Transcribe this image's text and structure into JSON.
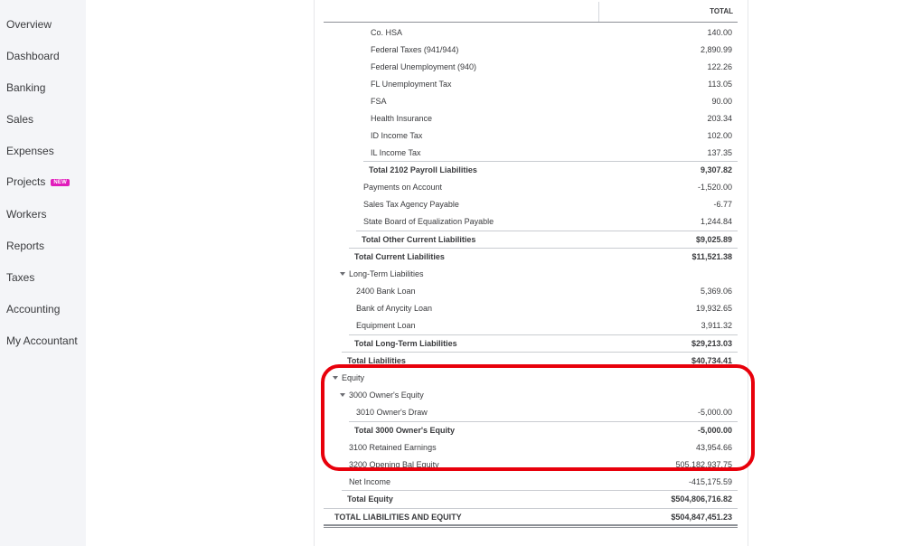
{
  "sidebar": {
    "items": [
      {
        "label": "Overview"
      },
      {
        "label": "Dashboard"
      },
      {
        "label": "Banking"
      },
      {
        "label": "Sales"
      },
      {
        "label": "Expenses"
      },
      {
        "label": "Projects",
        "badge": "NEW"
      },
      {
        "label": "Workers"
      },
      {
        "label": "Reports"
      },
      {
        "label": "Taxes"
      },
      {
        "label": "Accounting"
      },
      {
        "label": "My Accountant"
      }
    ]
  },
  "report": {
    "column_header": "TOTAL",
    "rows": [
      {
        "label": "Co. HSA",
        "amount": "140.00"
      },
      {
        "label": "Federal Taxes (941/944)",
        "amount": "2,890.99"
      },
      {
        "label": "Federal Unemployment (940)",
        "amount": "122.26"
      },
      {
        "label": "FL Unemployment Tax",
        "amount": "113.05"
      },
      {
        "label": "FSA",
        "amount": "90.00"
      },
      {
        "label": "Health Insurance",
        "amount": "203.34"
      },
      {
        "label": "ID Income Tax",
        "amount": "102.00"
      },
      {
        "label": "IL Income Tax",
        "amount": "137.35"
      },
      {
        "label": "Total 2102 Payroll Liabilities",
        "amount": "9,307.82"
      },
      {
        "label": "Payments on Account",
        "amount": "-1,520.00"
      },
      {
        "label": "Sales Tax Agency Payable",
        "amount": "-6.77"
      },
      {
        "label": "State Board of Equalization Payable",
        "amount": "1,244.84"
      },
      {
        "label": "Total Other Current Liabilities",
        "amount": "$9,025.89"
      },
      {
        "label": "Total Current Liabilities",
        "amount": "$11,521.38"
      },
      {
        "label": "Long-Term Liabilities",
        "amount": ""
      },
      {
        "label": "2400 Bank Loan",
        "amount": "5,369.06"
      },
      {
        "label": "Bank of Anycity Loan",
        "amount": "19,932.65"
      },
      {
        "label": "Equipment Loan",
        "amount": "3,911.32"
      },
      {
        "label": "Total Long-Term Liabilities",
        "amount": "$29,213.03"
      },
      {
        "label": "Total Liabilities",
        "amount": "$40,734.41"
      },
      {
        "label": "Equity",
        "amount": ""
      },
      {
        "label": "3000 Owner's Equity",
        "amount": ""
      },
      {
        "label": "3010 Owner's Draw",
        "amount": "-5,000.00"
      },
      {
        "label": "Total 3000 Owner's Equity",
        "amount": "-5,000.00"
      },
      {
        "label": "3100 Retained Earnings",
        "amount": "43,954.66"
      },
      {
        "label": "3200 Opening Bal Equity",
        "amount": "505,182,937.75"
      },
      {
        "label": "Net Income",
        "amount": "-415,175.59"
      },
      {
        "label": "Total Equity",
        "amount": "$504,806,716.82"
      },
      {
        "label": "TOTAL LIABILITIES AND EQUITY",
        "amount": "$504,847,451.23"
      }
    ]
  }
}
